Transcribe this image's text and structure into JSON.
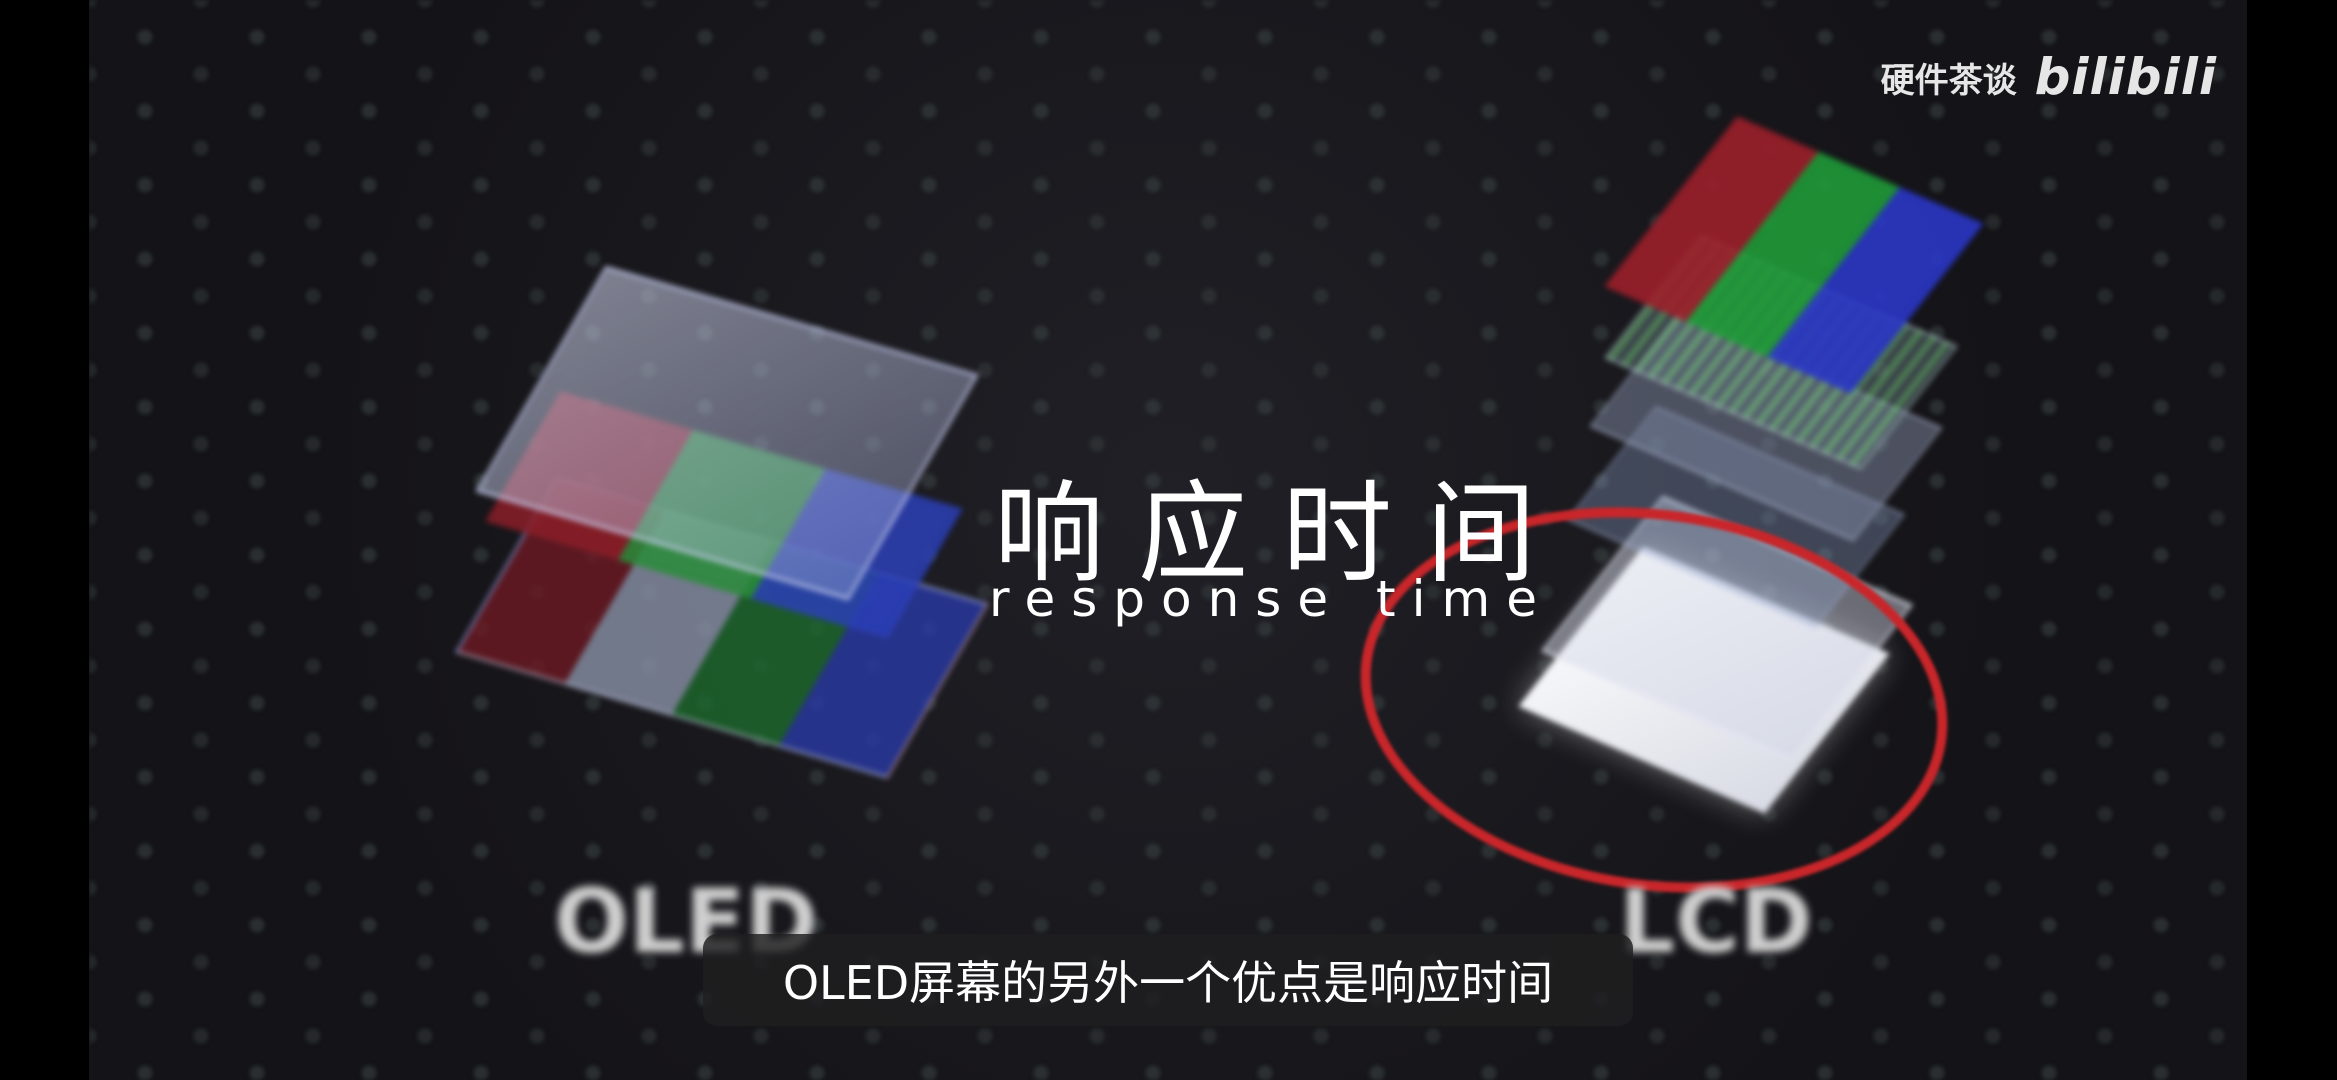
{
  "video": {
    "title_cn": "响应时间",
    "title_en": "response time",
    "labels": {
      "oled": "OLED",
      "lcd": "LCD"
    },
    "watermark": {
      "channel": "硬件茶谈",
      "logo": "bilibili"
    },
    "subtitle": "OLED屏幕的另外一个优点是响应时间",
    "colors": {
      "highlight_ellipse": "#c8262a",
      "background": "#141317"
    }
  }
}
